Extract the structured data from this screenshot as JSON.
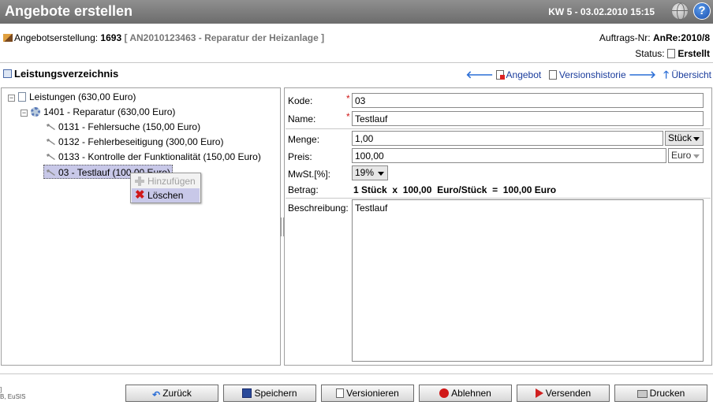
{
  "app": {
    "title": "Angebote erstellen",
    "datetime": "KW 5 - 03.02.2010 15:15"
  },
  "header": {
    "info_label": "Angebotserstellung:",
    "info_number": "1693",
    "info_ref": "[ AN2010123463 - Reparatur der Heizanlage ]",
    "order_label": "Auftrags-Nr:",
    "order_value": "AnRe:2010/8",
    "status_label": "Status:",
    "status_value": "Erstellt"
  },
  "section": {
    "title": "Leistungsverzeichnis",
    "links": {
      "angebot": "Angebot",
      "versionshistorie": "Versionshistorie",
      "uebersicht": "Übersicht"
    }
  },
  "tree": {
    "root": "Leistungen (630,00 Euro)",
    "group": "1401 - Reparatur (630,00 Euro)",
    "items": [
      "0131 - Fehlersuche (150,00 Euro)",
      "0132 - Fehlerbeseitigung (300,00 Euro)",
      "0133 - Kontrolle der Funktionalität (150,00 Euro)",
      "03 - Testlauf (100,00 Euro)"
    ]
  },
  "context_menu": {
    "add": "Hinzufügen",
    "delete": "Löschen"
  },
  "form": {
    "code_label": "Kode:",
    "code_value": "03",
    "name_label": "Name:",
    "name_value": "Testlauf",
    "quantity_label": "Menge:",
    "quantity_value": "1,00",
    "unit_value": "Stück",
    "price_label": "Preis:",
    "price_value": "100,00",
    "currency_value": "Euro",
    "vat_label": "MwSt.[%]:",
    "vat_value": "19%",
    "amount_label": "Betrag:",
    "amount_value": "1 Stück  x  100,00  Euro/Stück  =  100,00 Euro",
    "desc_label": "Beschreibung:",
    "desc_value": "Testlauf",
    "required_mark": "*"
  },
  "buttons": {
    "back": "Zurück",
    "save": "Speichern",
    "version": "Versionieren",
    "reject": "Ablehnen",
    "send": "Versenden",
    "print": "Drucken"
  },
  "footer": {
    "line1": "]",
    "line2": "B, EuSIS"
  },
  "colors": {
    "titlebar": "#7a7a7a",
    "link": "#1a3c9c",
    "selection": "#c8c8e8",
    "required": "#d01818"
  }
}
